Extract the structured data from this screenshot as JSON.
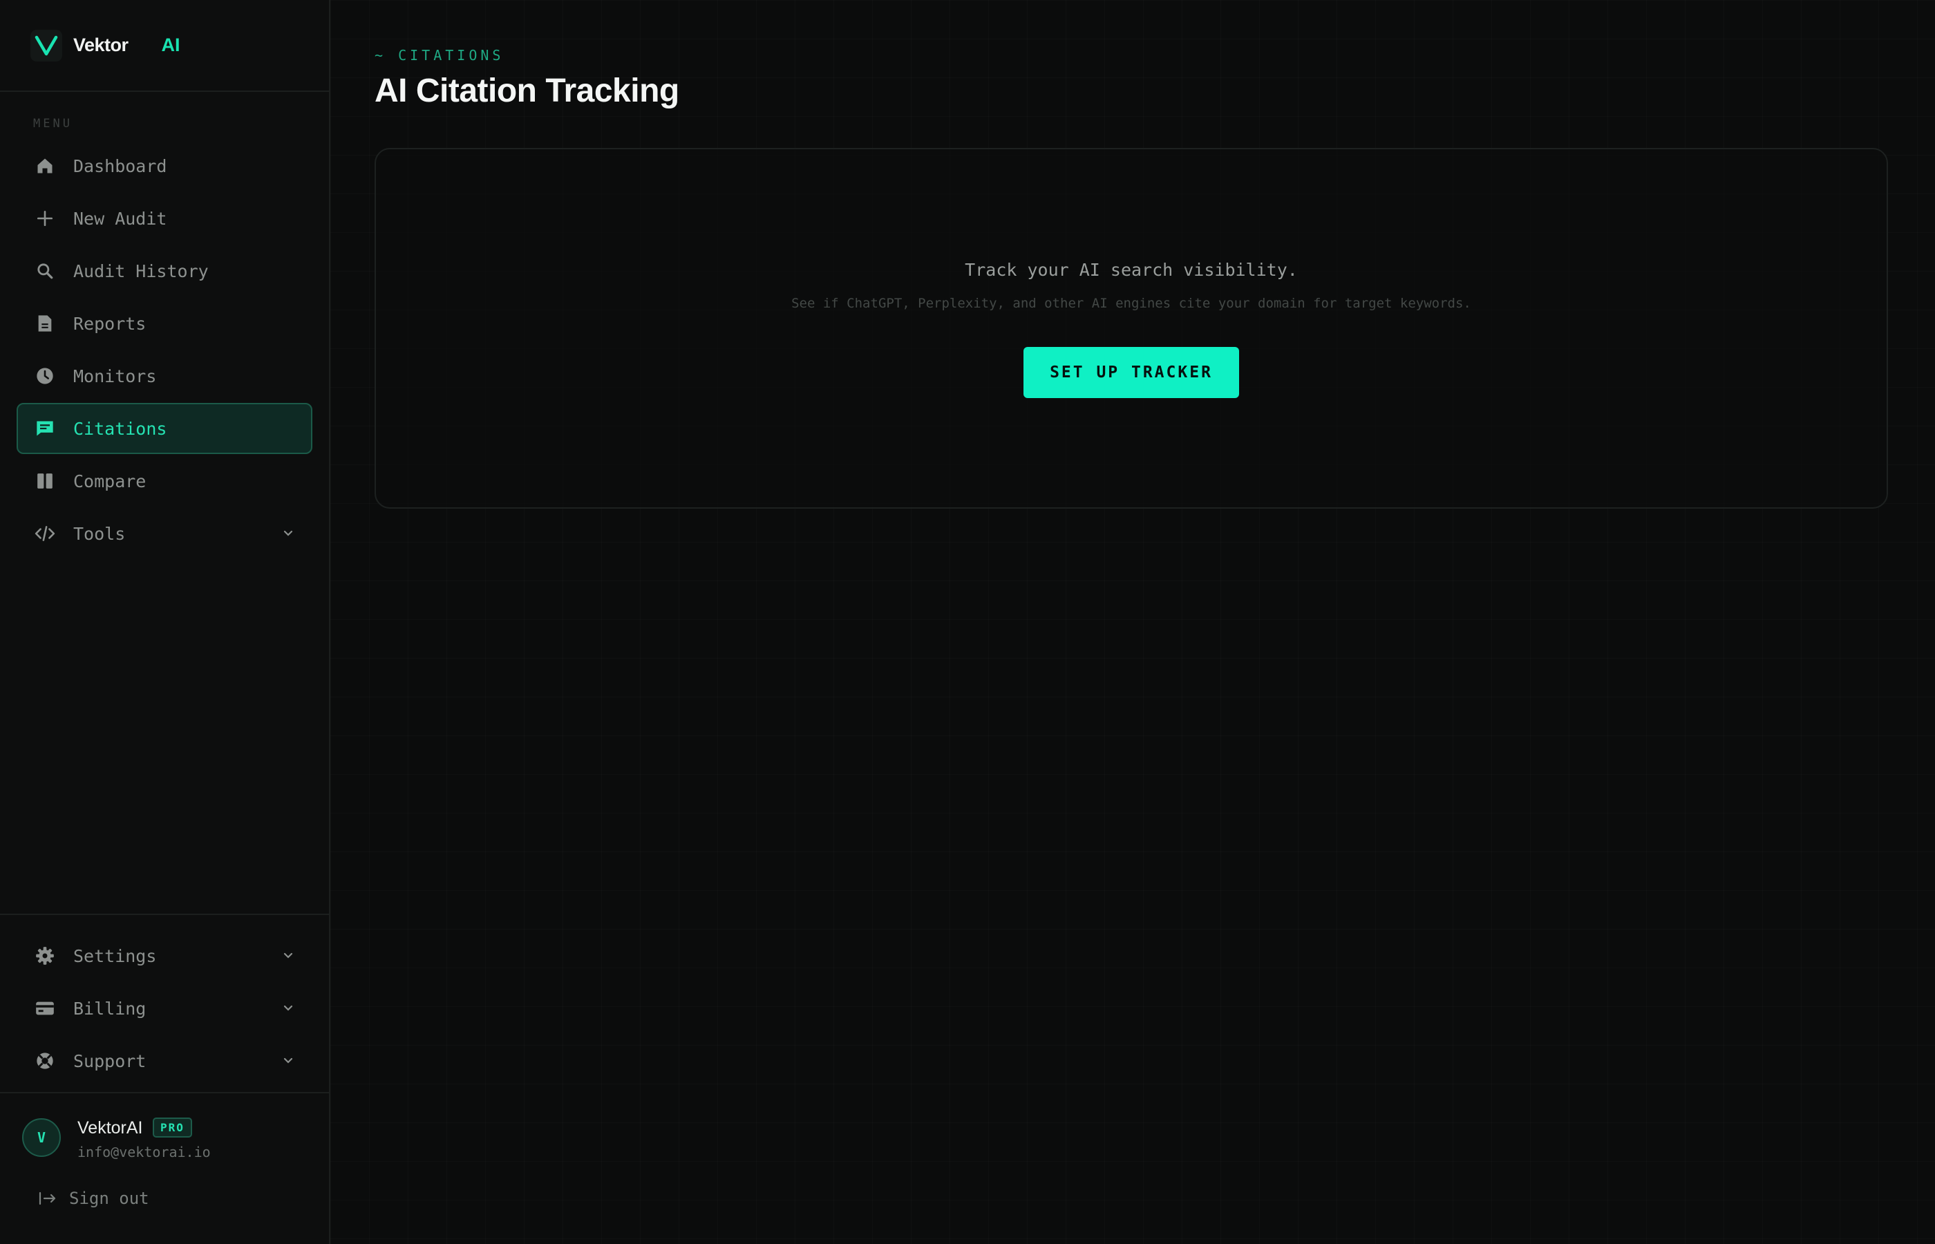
{
  "brand": {
    "name": "Vektor",
    "suffix": "AI"
  },
  "sidebar": {
    "menu_label": "MENU",
    "items": [
      {
        "label": "Dashboard",
        "icon": "home-icon"
      },
      {
        "label": "New Audit",
        "icon": "plus-icon"
      },
      {
        "label": "Audit History",
        "icon": "search-icon"
      },
      {
        "label": "Reports",
        "icon": "document-icon"
      },
      {
        "label": "Monitors",
        "icon": "clock-icon"
      },
      {
        "label": "Citations",
        "icon": "chat-bubble-icon",
        "active": true
      },
      {
        "label": "Compare",
        "icon": "columns-icon"
      },
      {
        "label": "Tools",
        "icon": "code-icon",
        "expandable": true
      }
    ],
    "bottom_items": [
      {
        "label": "Settings",
        "icon": "gear-icon",
        "expandable": true
      },
      {
        "label": "Billing",
        "icon": "credit-card-icon",
        "expandable": true
      },
      {
        "label": "Support",
        "icon": "lifebuoy-icon",
        "expandable": true
      }
    ],
    "user": {
      "avatar_initial": "V",
      "name": "VektorAI",
      "plan_badge": "PRO",
      "email": "info@vektorai.io",
      "signout_label": "Sign out"
    }
  },
  "main": {
    "eyebrow": "~ CITATIONS",
    "title": "AI Citation Tracking",
    "empty_state": {
      "title": "Track your AI search visibility.",
      "subtitle": "See if ChatGPT, Perplexity, and other AI engines cite your domain for target keywords.",
      "cta_label": "SET UP TRACKER"
    }
  },
  "colors": {
    "accent": "#19e3b1",
    "cta_bg": "#0ff0c4",
    "background": "#0b0c0c",
    "sidebar_bg": "#0d0e0e"
  }
}
